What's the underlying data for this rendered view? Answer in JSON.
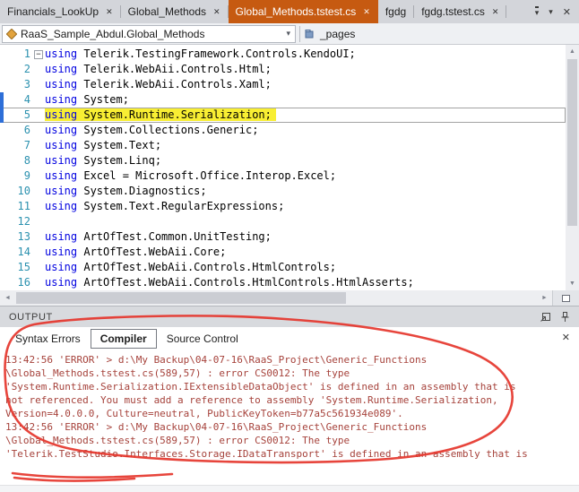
{
  "colors": {
    "active_tab": "#c65a11",
    "tab_bar_bg": "#d3d5da",
    "keyword": "#0000e0",
    "line_number": "#2b91af",
    "highlight": "#f8ee33",
    "error_text": "#a6423b",
    "annotation": "#e5352b"
  },
  "icons": {
    "close": "✕",
    "collapse": "−",
    "caret_down": "▾",
    "dropdown_arrow": "▾",
    "left_arrow": "◄",
    "right_arrow": "►",
    "up_arrow": "▲",
    "down_arrow": "▼"
  },
  "tab_bar": {
    "tabs": [
      {
        "label": "Financials_LookUp",
        "active": false,
        "closable": true
      },
      {
        "label": "Global_Methods",
        "active": false,
        "closable": true
      },
      {
        "label": "Global_Methods.tstest.cs",
        "active": true,
        "closable": true
      },
      {
        "label": "fgdg",
        "active": false,
        "closable": false
      },
      {
        "label": "fgdg.tstest.cs",
        "active": false,
        "closable": true
      }
    ]
  },
  "nav_bar": {
    "type_selector": "RaaS_Sample_Abdul.Global_Methods",
    "member_selector": "_pages"
  },
  "editor": {
    "lines": [
      {
        "n": 1,
        "kw": "using",
        "code": " Telerik.TestingFramework.Controls.KendoUI;",
        "fold": true
      },
      {
        "n": 2,
        "kw": "using",
        "code": " Telerik.WebAii.Controls.Html;"
      },
      {
        "n": 3,
        "kw": "using",
        "code": " Telerik.WebAii.Controls.Xaml;"
      },
      {
        "n": 4,
        "kw": "using",
        "code": " System;",
        "changed": true
      },
      {
        "n": 5,
        "kw": "using",
        "code": " System.Runtime.Serialization;",
        "highlight": true,
        "changed": true
      },
      {
        "n": 6,
        "kw": "using",
        "code": " System.Collections.Generic;"
      },
      {
        "n": 7,
        "kw": "using",
        "code": " System.Text;"
      },
      {
        "n": 8,
        "kw": "using",
        "code": " System.Linq;"
      },
      {
        "n": 9,
        "kw": "using",
        "code": " Excel = Microsoft.Office.Interop.Excel;"
      },
      {
        "n": 10,
        "kw": "using",
        "code": " System.Diagnostics;"
      },
      {
        "n": 11,
        "kw": "using",
        "code": " System.Text.RegularExpressions;"
      },
      {
        "n": 12,
        "kw": "",
        "code": ""
      },
      {
        "n": 13,
        "kw": "using",
        "code": " ArtOfTest.Common.UnitTesting;"
      },
      {
        "n": 14,
        "kw": "using",
        "code": " ArtOfTest.WebAii.Core;"
      },
      {
        "n": 15,
        "kw": "using",
        "code": " ArtOfTest.WebAii.Controls.HtmlControls;"
      },
      {
        "n": 16,
        "kw": "using",
        "code": " ArtOfTest.WebAii.Controls.HtmlControls.HtmlAsserts;"
      }
    ]
  },
  "output": {
    "title": "OUTPUT",
    "tabs": [
      {
        "label": "Syntax Errors",
        "active": false
      },
      {
        "label": "Compiler",
        "active": true
      },
      {
        "label": "Source Control",
        "active": false
      }
    ],
    "log": [
      "13:42:56 'ERROR' > d:\\My Backup\\04-07-16\\RaaS_Project\\Generic_Functions",
      "\\Global_Methods.tstest.cs(589,57) : error CS0012: The type",
      "'System.Runtime.Serialization.IExtensibleDataObject' is defined in an assembly that is",
      "not referenced. You must add a reference to assembly 'System.Runtime.Serialization,",
      "Version=4.0.0.0, Culture=neutral, PublicKeyToken=b77a5c561934e089'.",
      "13:42:56 'ERROR' > d:\\My Backup\\04-07-16\\RaaS_Project\\Generic_Functions",
      "\\Global_Methods.tstest.cs(589,57) : error CS0012: The type",
      "'Telerik.TestStudio.Interfaces.Storage.IDataTransport' is defined in an assembly that is"
    ]
  }
}
